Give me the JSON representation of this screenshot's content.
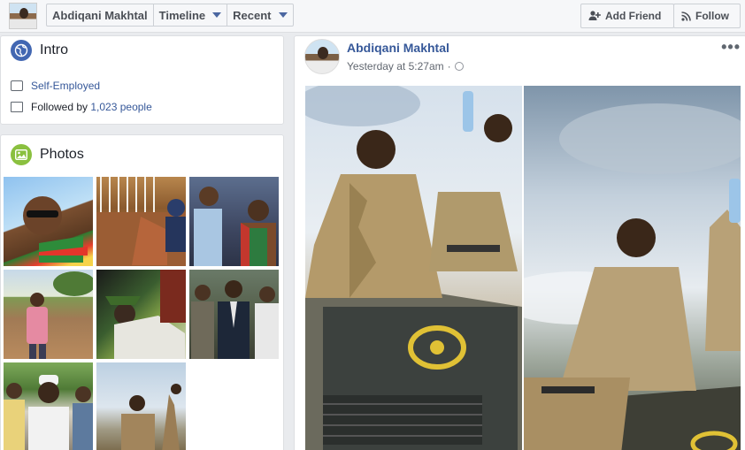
{
  "header": {
    "profile_name": "Abdiqani Makhtal",
    "tabs": [
      {
        "label": "Abdiqani Makhtal"
      },
      {
        "label": "Timeline"
      },
      {
        "label": "Recent"
      }
    ],
    "add_friend_label": "Add Friend",
    "follow_label": "Follow"
  },
  "intro": {
    "title": "Intro",
    "work": "Self-Employed",
    "followed_prefix": "Followed by ",
    "followed_count": "1,023 people"
  },
  "photos": {
    "title": "Photos",
    "count": 8
  },
  "post": {
    "author": "Abdiqani Makhtal",
    "timestamp": "Yesterday at 5:27am",
    "separator": "·",
    "more": "•••"
  },
  "icons": {
    "intro": "globe-icon",
    "photos": "photo-icon",
    "work": "briefcase-icon",
    "followers": "followers-icon",
    "privacy": "public-icon",
    "add_friend": "add-friend-icon",
    "follow": "rss-icon"
  },
  "colors": {
    "link": "#365899",
    "brand": "#4267b2",
    "photos_icon": "#8ac03f",
    "background": "#e9ebee"
  }
}
